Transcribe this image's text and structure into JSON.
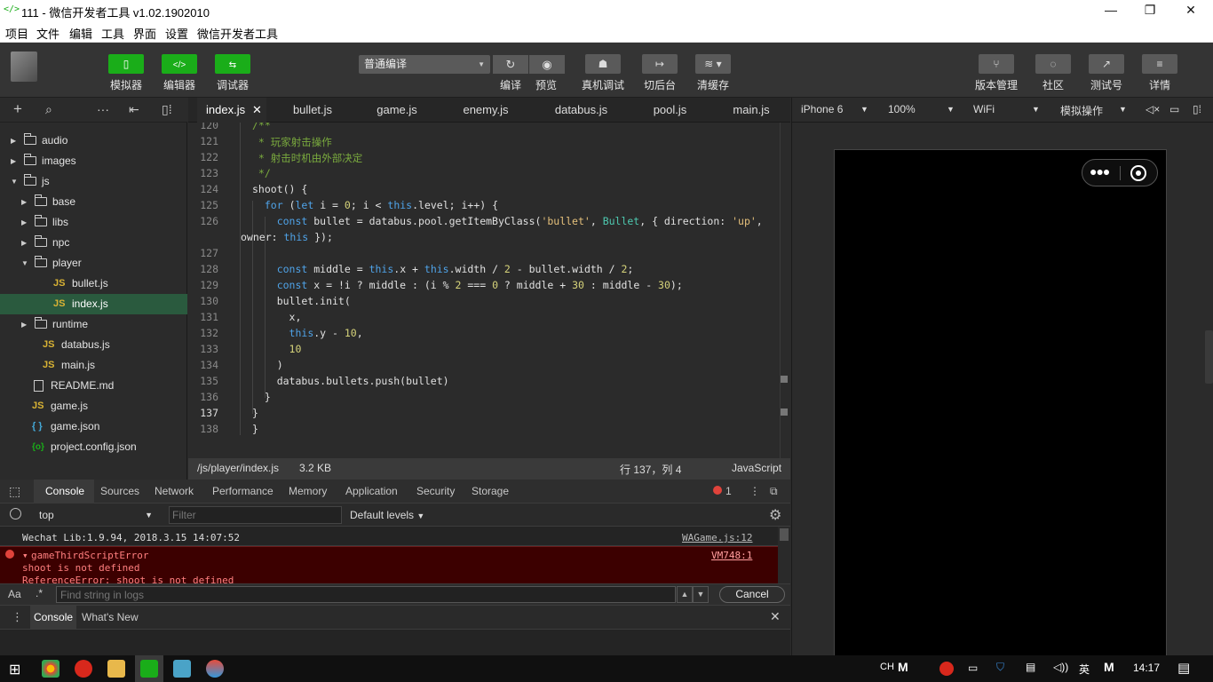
{
  "window": {
    "title": "111 - 微信开发者工具 v1.02.1902010",
    "app_icon": "</>",
    "controls": [
      "—",
      "❐",
      "✕"
    ]
  },
  "menu": [
    "项目",
    "文件",
    "编辑",
    "工具",
    "界面",
    "设置",
    "微信开发者工具"
  ],
  "toolbar": {
    "left_buttons": [
      {
        "label": "模拟器",
        "icon": "phone-icon"
      },
      {
        "label": "编辑器",
        "icon": "code-icon"
      },
      {
        "label": "调试器",
        "icon": "debug-icon"
      }
    ],
    "compile_mode": "普通编译",
    "center_buttons": [
      {
        "label": "编译",
        "icon": "refresh-icon"
      },
      {
        "label": "预览",
        "icon": "eye-icon"
      },
      {
        "label": "真机调试",
        "icon": "bug-icon"
      },
      {
        "label": "切后台",
        "icon": "background-icon"
      },
      {
        "label": "清缓存",
        "icon": "layers-icon"
      }
    ],
    "right_buttons": [
      {
        "label": "版本管理",
        "icon": "branch-icon"
      },
      {
        "label": "社区",
        "icon": "chat-icon"
      },
      {
        "label": "测试号",
        "icon": "share-icon"
      },
      {
        "label": "详情",
        "icon": "menu-icon"
      }
    ]
  },
  "file_tree": [
    {
      "label": "audio",
      "type": "folder",
      "depth": 0,
      "expanded": false
    },
    {
      "label": "images",
      "type": "folder",
      "depth": 0,
      "expanded": false
    },
    {
      "label": "js",
      "type": "folder",
      "depth": 0,
      "expanded": true
    },
    {
      "label": "base",
      "type": "folder",
      "depth": 1,
      "expanded": false
    },
    {
      "label": "libs",
      "type": "folder",
      "depth": 1,
      "expanded": false
    },
    {
      "label": "npc",
      "type": "folder",
      "depth": 1,
      "expanded": false
    },
    {
      "label": "player",
      "type": "folder",
      "depth": 1,
      "expanded": true
    },
    {
      "label": "bullet.js",
      "type": "js",
      "depth": 2
    },
    {
      "label": "index.js",
      "type": "js",
      "depth": 2,
      "selected": true
    },
    {
      "label": "runtime",
      "type": "folder",
      "depth": 1,
      "expanded": false
    },
    {
      "label": "databus.js",
      "type": "js",
      "depth": 1
    },
    {
      "label": "main.js",
      "type": "js",
      "depth": 1
    },
    {
      "label": "README.md",
      "type": "file",
      "depth": 0
    },
    {
      "label": "game.js",
      "type": "js",
      "depth": 0
    },
    {
      "label": "game.json",
      "type": "json",
      "depth": 0
    },
    {
      "label": "project.config.json",
      "type": "config",
      "depth": 0
    }
  ],
  "editor_tabs": [
    "index.js",
    "bullet.js",
    "game.js",
    "enemy.js",
    "databus.js",
    "pool.js",
    "main.js"
  ],
  "code_lines": [
    {
      "n": "120",
      "t": "/**"
    },
    {
      "n": "121",
      "t": " * 玩家射击操作"
    },
    {
      "n": "122",
      "t": " * 射击时机由外部决定"
    },
    {
      "n": "123",
      "t": " */"
    },
    {
      "n": "124",
      "t": "shoot() {"
    },
    {
      "n": "125",
      "t": "  for (let i = 0; i < this.level; i++) {"
    },
    {
      "n": "126",
      "t": "    const bullet = databus.pool.getItemByClass('bullet', Bullet, { direction: 'up',"
    },
    {
      "n": "",
      "t": "owner: this });"
    },
    {
      "n": "127",
      "t": ""
    },
    {
      "n": "128",
      "t": "    const middle = this.x + this.width / 2 - bullet.width / 2;"
    },
    {
      "n": "129",
      "t": "    const x = !i ? middle : (i % 2 === 0 ? middle + 30 : middle - 30);"
    },
    {
      "n": "130",
      "t": "    bullet.init("
    },
    {
      "n": "131",
      "t": "      x,"
    },
    {
      "n": "132",
      "t": "      this.y - 10,"
    },
    {
      "n": "133",
      "t": "      10"
    },
    {
      "n": "134",
      "t": "    )"
    },
    {
      "n": "135",
      "t": "    databus.bullets.push(bullet)"
    },
    {
      "n": "136",
      "t": "  }"
    },
    {
      "n": "137",
      "t": "}"
    },
    {
      "n": "138",
      "t": "}"
    }
  ],
  "status": {
    "path": "/js/player/index.js",
    "size": "3.2 KB",
    "cursor": "行 137，列 4",
    "language": "JavaScript"
  },
  "devtools": {
    "tabs": [
      "Console",
      "Sources",
      "Network",
      "Performance",
      "Memory",
      "Application",
      "Security",
      "Storage"
    ],
    "error_count": "1",
    "context": "top",
    "filter_placeholder": "Filter",
    "levels": "Default levels",
    "logs": {
      "info_text": "Wechat Lib:1.9.94, 2018.3.15 14:07:52",
      "info_src": "WAGame.js:12",
      "error_title": "gameThirdScriptError",
      "error_line1": "shoot is not defined",
      "error_line2": "ReferenceError: shoot is not defined",
      "error_src": "VM748:1"
    },
    "search_case": "Aa",
    "search_regex": ".*",
    "search_placeholder": "Find string in logs",
    "cancel": "Cancel",
    "drawer_tabs": [
      "Console",
      "What's New"
    ]
  },
  "simulator": {
    "device": "iPhone 6",
    "zoom": "100%",
    "network": "WiFi",
    "mode": "模拟操作"
  },
  "taskbar": {
    "ime1": "CH",
    "ime_m": "M",
    "lang": "英",
    "time": "14:17"
  },
  "colors": {
    "accent_green": "#1aad19",
    "selected_row": "#2a5a3e",
    "error_bg": "#3c0000"
  }
}
